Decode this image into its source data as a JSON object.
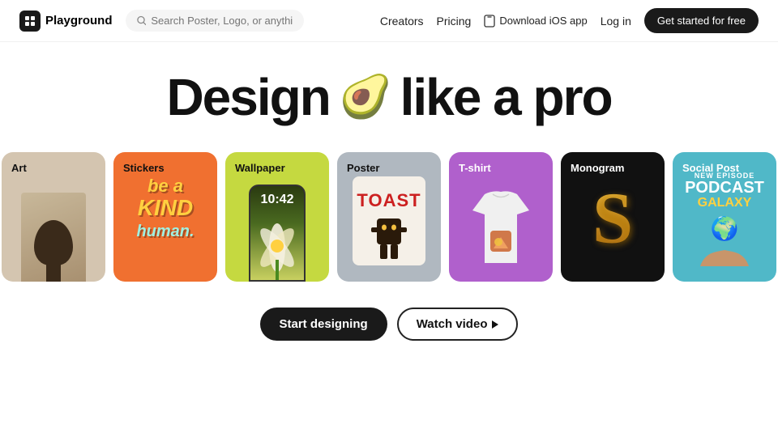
{
  "app": {
    "name": "Playground",
    "logo_text": "Playground"
  },
  "nav": {
    "search_placeholder": "Search Poster, Logo, or anything",
    "links": [
      "Creators",
      "Pricing"
    ],
    "ios_label": "Download iOS app",
    "login_label": "Log in",
    "cta_label": "Get started for free"
  },
  "hero": {
    "title_part1": "Design",
    "title_emoji": "🥑",
    "title_part2": "like a pro"
  },
  "cards": [
    {
      "id": "art",
      "label": "Art",
      "label_color": "dark"
    },
    {
      "id": "stickers",
      "label": "Stickers",
      "label_color": "dark"
    },
    {
      "id": "wallpaper",
      "label": "Wallpaper",
      "label_color": "dark"
    },
    {
      "id": "poster",
      "label": "Poster",
      "label_color": "dark"
    },
    {
      "id": "tshirt",
      "label": "T-shirt",
      "label_color": "light"
    },
    {
      "id": "monogram",
      "label": "Monogram",
      "label_color": "light"
    },
    {
      "id": "social",
      "label": "Social Post",
      "label_color": "light"
    }
  ],
  "sticker": {
    "line1": "be a",
    "line2": "KIND",
    "line3": "human."
  },
  "phone": {
    "time": "10:42"
  },
  "poster": {
    "title": "TOAST"
  },
  "social": {
    "new_episode": "NEW EPISODE",
    "podcast": "PODCAST",
    "galaxy": "GALAXY"
  },
  "buttons": {
    "start": "Start designing",
    "watch": "Watch video"
  }
}
